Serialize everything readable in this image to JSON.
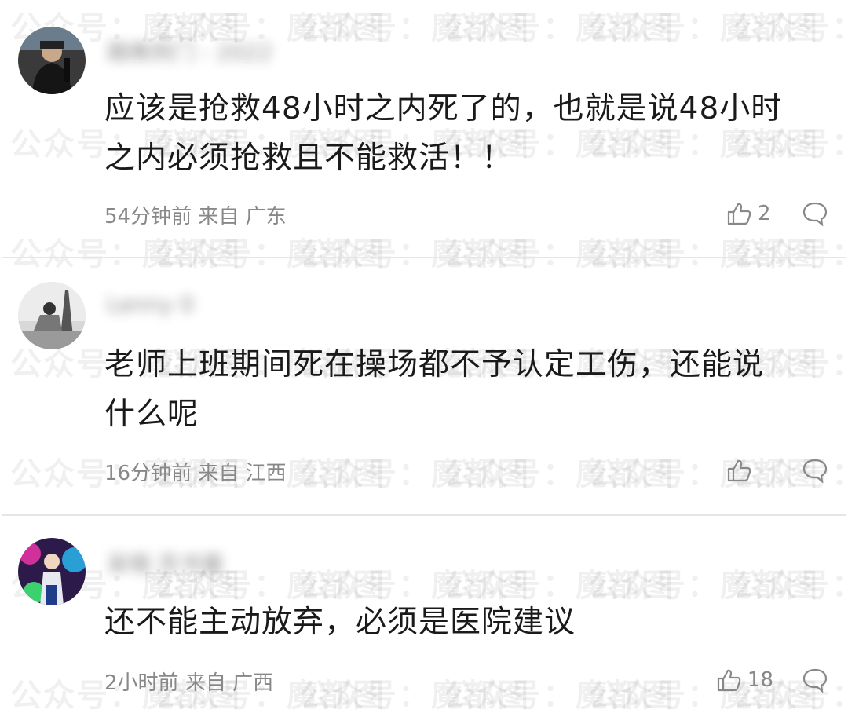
{
  "watermark": "公众号：魔都图",
  "comments": [
    {
      "username": "路晚到门 - 2022",
      "text_line1": "应该是抢救48小时之内死了的，也就是说48小时",
      "text_line2": "之内必须抢救且不能救活！！",
      "time": "54分钟前",
      "location": "来自 广东",
      "likes": "2"
    },
    {
      "username": "Lenny 0",
      "text_line1": "老师上班期间死在操场都不予认定工伤，还能说",
      "text_line2": "什么呢",
      "time": "16分钟前",
      "location": "来自 江西",
      "likes": ""
    },
    {
      "username": "呆哦 苏书童",
      "text_line1": "还不能主动放弃，必须是医院建议",
      "text_line2": "",
      "time": "2小时前",
      "location": "来自 广西",
      "likes": "18"
    }
  ],
  "icons": {
    "like": "thumbs-up-icon",
    "reply": "speech-bubble-icon"
  },
  "colors": {
    "text": "#1a1a1a",
    "meta": "#888888",
    "divider": "#e6e6e6"
  }
}
